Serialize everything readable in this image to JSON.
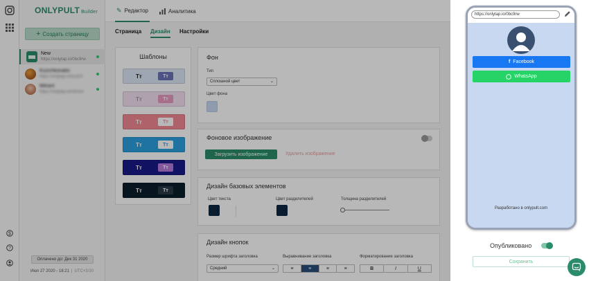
{
  "brand": {
    "name": "ONLYPULT",
    "suffix": "Builder"
  },
  "sidebar": {
    "create_label": "Создать страницу",
    "pages": [
      {
        "title": "New",
        "url": "https://onlytap.io/0bc9rw",
        "status": "online"
      },
      {
        "title": "Kuzichkonatio",
        "url": "https://onlytap.io/kuzich",
        "status": "online"
      },
      {
        "title": "Mitrant",
        "url": "https://onlytap.io/mitrant",
        "status": "online"
      }
    ],
    "paid_until": "Оплачено до: Дек 31 2020",
    "current_date": "Июл 27 2020 - 18:21",
    "timezone": "UTC+3:00"
  },
  "top_tabs": [
    {
      "label": "Редактор",
      "icon": "pencil-icon",
      "active": true
    },
    {
      "label": "Аналитика",
      "icon": "bar-chart-icon",
      "active": false
    }
  ],
  "sub_tabs": [
    {
      "label": "Страница",
      "active": false
    },
    {
      "label": "Дизайн",
      "active": true
    },
    {
      "label": "Настройки",
      "active": false
    }
  ],
  "templates": {
    "title": "Шаблоны",
    "sample": "Тт",
    "items": [
      {
        "bg": "#dce6f5",
        "text": "#222",
        "btn_bg": "#6a72b8",
        "btn_text": "#fff"
      },
      {
        "bg": "#f4dff2",
        "text": "#999",
        "btn_bg": "#e59bbd",
        "btn_text": "#fff"
      },
      {
        "bg": "#f28a94",
        "text": "#fff",
        "btn_bg": "#fff",
        "btn_text": "#e88a94"
      },
      {
        "bg": "#2aa0e0",
        "text": "#fff",
        "btn_bg": "#fff",
        "btn_text": "#2aa0e0"
      },
      {
        "bg": "#1a1a8a",
        "text": "#fff",
        "btn_bg": "#b77ad8",
        "btn_text": "#fff"
      },
      {
        "bg": "#0b1e2c",
        "text": "#fff",
        "btn_bg": "#2a3a48",
        "btn_text": "#fff"
      }
    ]
  },
  "background": {
    "title": "Фон",
    "type_label": "Тип",
    "type_value": "Сплошной цвет",
    "color_label": "Цвет фона",
    "color": "#c8d8f0"
  },
  "bg_image": {
    "title": "Фоновое изображение",
    "upload_label": "Загрузить изображение",
    "delete_label": "Удалить изображение"
  },
  "base_elements": {
    "title": "Дизайн базовых элементов",
    "text_color_label": "Цвет текста",
    "divider_color_label": "Цвет разделителей",
    "divider_width_label": "Толщина разделителей",
    "text_color": "#0a2740",
    "divider_color": "#0a2740"
  },
  "buttons_design": {
    "title": "Дизайн кнопок",
    "font_size_label": "Размер шрифта заголовка",
    "font_size_value": "Средний",
    "align_label": "Выравнивание заголовка",
    "format_label": "Форматирование заголовка",
    "format_buttons": [
      "B",
      "I",
      "U"
    ]
  },
  "preview": {
    "url": "https://onlytap.io/0bc9rw",
    "buttons": [
      {
        "label": "Facebook",
        "color": "#1877f2",
        "icon": "facebook-icon"
      },
      {
        "label": "WhatsApp",
        "color": "#25d366",
        "icon": "whatsapp-icon"
      }
    ],
    "powered_by": "Разработано в onlypult.com",
    "published_label": "Опубликовано",
    "save_label": "Сохранить"
  }
}
